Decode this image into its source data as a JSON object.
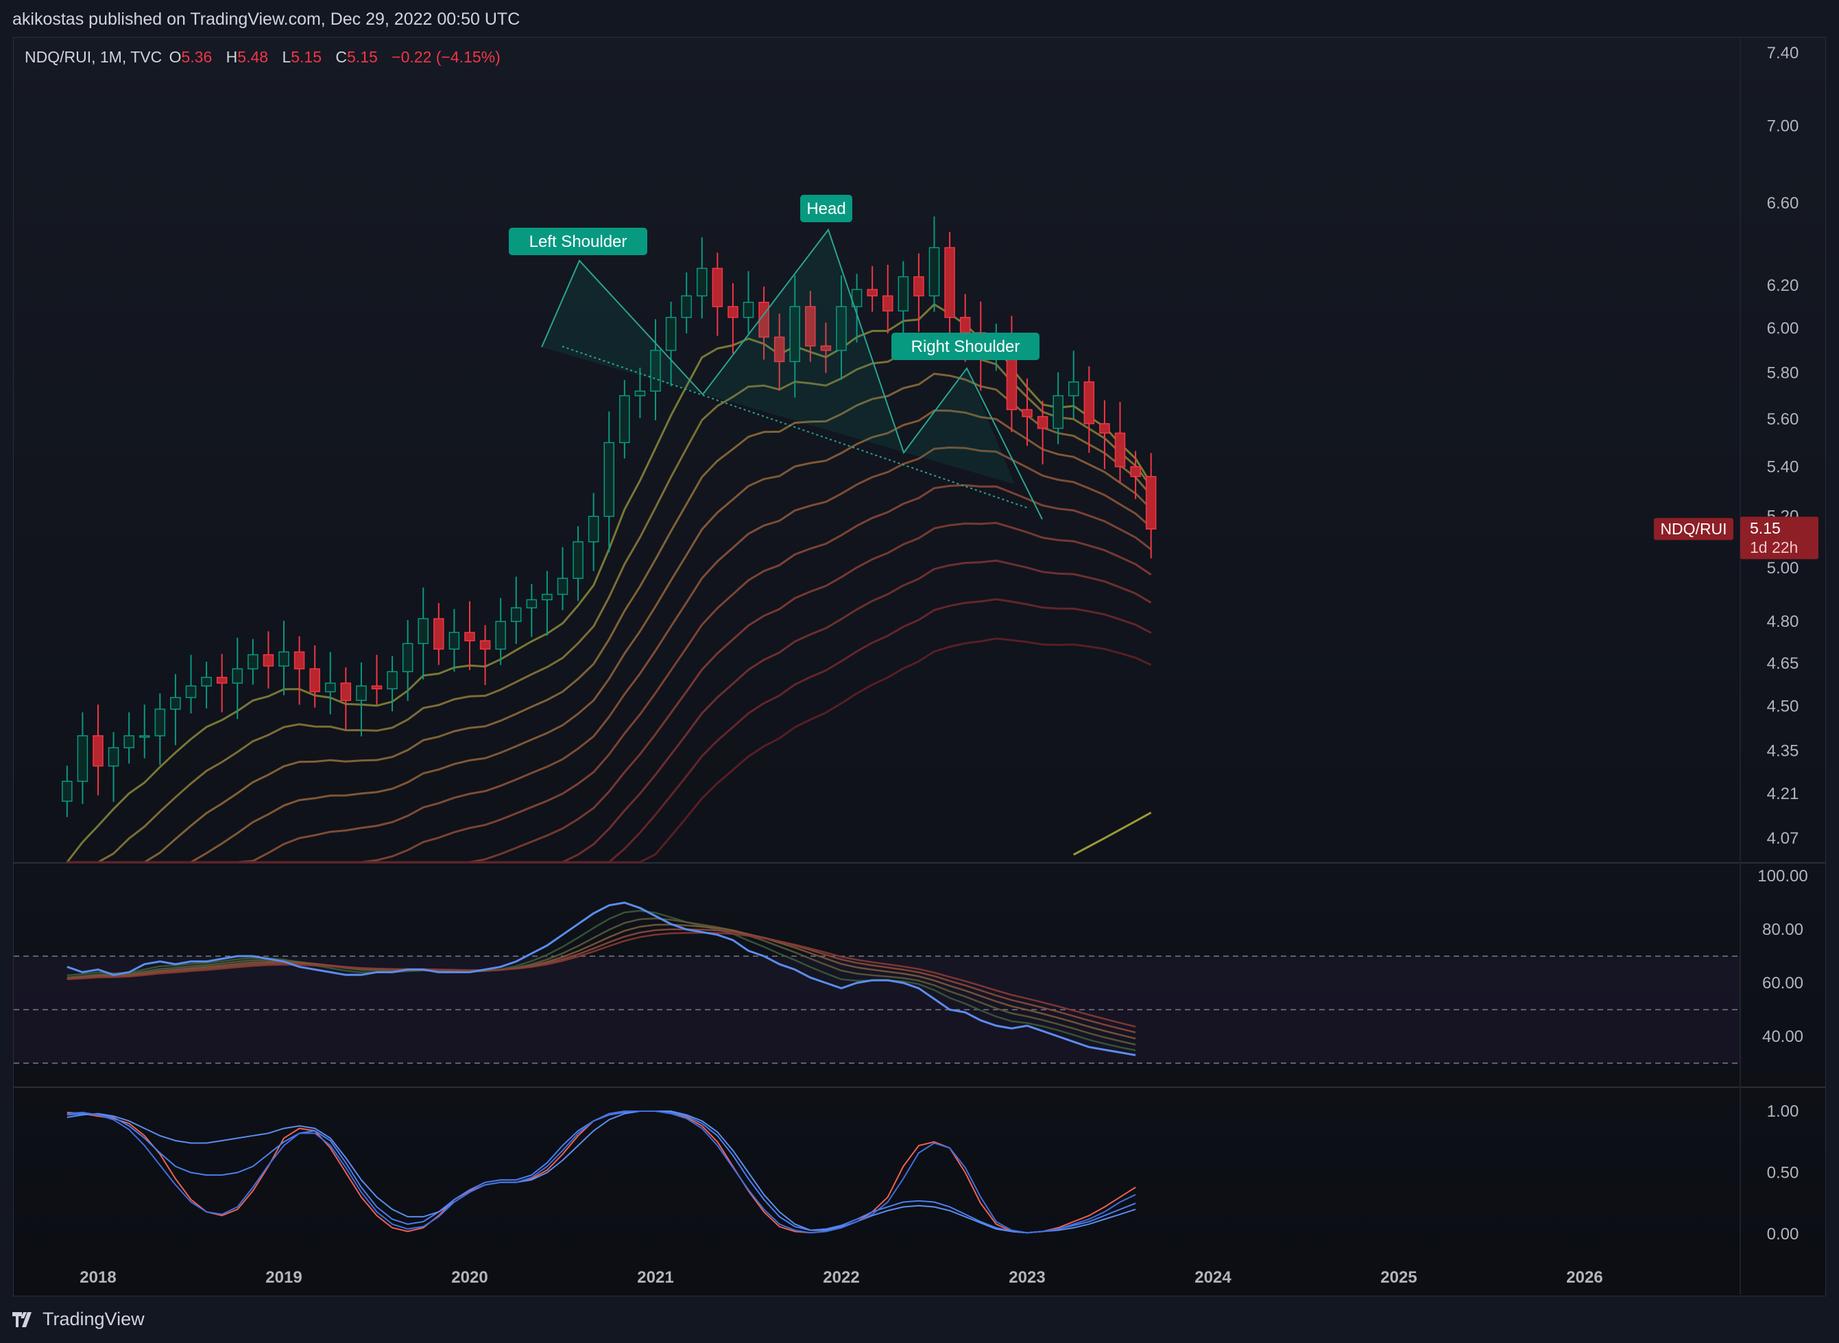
{
  "header": {
    "publisher": "akikostas published on TradingView.com, Dec 29, 2022 00:50 UTC"
  },
  "legend": {
    "symbol": "NDQ/RUI, 1M, TVC",
    "open_label": "O",
    "open": "5.36",
    "high_label": "H",
    "high": "5.48",
    "low_label": "L",
    "low": "5.15",
    "close_label": "C",
    "close": "5.15",
    "change": "−0.22 (−4.15%)"
  },
  "price_tag": {
    "symbol": "NDQ/RUI",
    "price": "5.15",
    "countdown": "1d 22h"
  },
  "annotations": {
    "left_shoulder": "Left Shoulder",
    "head": "Head",
    "right_shoulder": "Right Shoulder"
  },
  "footer": {
    "brand": "TradingView"
  },
  "colors": {
    "up": "#089981",
    "down": "#f23645",
    "rsi_line": "#5b8def",
    "background": "#131722"
  },
  "chart_data": [
    {
      "type": "candlestick",
      "title": "NDQ/RUI, 1M, TVC",
      "scale": "log",
      "ylim": [
        4.0,
        7.5
      ],
      "yticks": [
        7.4,
        7.0,
        6.6,
        6.2,
        6.0,
        5.8,
        5.6,
        5.4,
        5.2,
        5.0,
        4.8,
        4.65,
        4.5,
        4.35,
        4.21,
        4.07
      ],
      "xticks": [
        "2018",
        "2019",
        "2020",
        "2021",
        "2022",
        "2023",
        "2024",
        "2025",
        "2026"
      ],
      "last_price": 5.15,
      "ohlc_last": {
        "open": 5.36,
        "high": 5.48,
        "low": 5.15,
        "close": 5.15
      },
      "closes_monthly_2017_11_to_2022_12": [
        4.25,
        4.4,
        4.3,
        4.36,
        4.4,
        4.4,
        4.49,
        4.53,
        4.57,
        4.6,
        4.58,
        4.63,
        4.68,
        4.64,
        4.69,
        4.63,
        4.55,
        4.58,
        4.52,
        4.57,
        4.56,
        4.62,
        4.72,
        4.81,
        4.7,
        4.76,
        4.73,
        4.7,
        4.8,
        4.85,
        4.88,
        4.9,
        4.96,
        5.1,
        5.2,
        5.5,
        5.7,
        5.72,
        5.9,
        6.05,
        6.15,
        6.28,
        6.1,
        6.05,
        6.12,
        5.96,
        5.85,
        6.1,
        5.92,
        5.9,
        6.1,
        6.18,
        6.15,
        6.08,
        6.24,
        6.15,
        6.38,
        6.05,
        5.98,
        5.88,
        5.95,
        5.64,
        5.61,
        5.56,
        5.7,
        5.76,
        5.58,
        5.54,
        5.4,
        5.36,
        5.15
      ],
      "patterns": [
        "Left Shoulder",
        "Head",
        "Right Shoulder"
      ]
    },
    {
      "type": "line",
      "title": "",
      "ylim": [
        30,
        100
      ],
      "yticks": [
        100.0,
        80.0,
        60.0,
        40.0
      ],
      "bands": [
        70,
        50,
        30
      ],
      "series": [
        {
          "values": [
            66,
            64,
            65,
            63,
            64,
            67,
            68,
            67,
            68,
            68,
            69,
            70,
            70,
            69,
            68,
            66,
            65,
            64,
            63,
            63,
            64,
            64,
            65,
            65,
            64,
            64,
            64,
            65,
            66,
            68,
            71,
            74,
            78,
            82,
            86,
            89,
            90,
            88,
            85,
            82,
            80,
            79,
            78,
            76,
            72,
            70,
            67,
            65,
            62,
            60,
            58,
            60,
            61,
            61,
            60,
            58,
            54,
            50,
            49,
            46,
            44,
            43,
            44,
            42,
            40,
            38,
            36,
            35,
            34,
            33
          ]
        }
      ]
    },
    {
      "type": "line",
      "title": "",
      "ylim": [
        0,
        1
      ],
      "yticks": [
        1.0,
        0.5,
        0.0
      ],
      "series": [
        {
          "values": [
            0.99,
            0.98,
            0.96,
            0.94,
            0.9,
            0.8,
            0.65,
            0.45,
            0.28,
            0.18,
            0.15,
            0.2,
            0.35,
            0.55,
            0.78,
            0.86,
            0.84,
            0.7,
            0.5,
            0.3,
            0.15,
            0.05,
            0.02,
            0.05,
            0.15,
            0.28,
            0.35,
            0.4,
            0.42,
            0.42,
            0.45,
            0.52,
            0.65,
            0.8,
            0.92,
            0.98,
            1.0,
            1.0,
            1.0,
            0.99,
            0.95,
            0.88,
            0.75,
            0.55,
            0.35,
            0.18,
            0.06,
            0.02,
            0.01,
            0.02,
            0.05,
            0.1,
            0.18,
            0.3,
            0.55,
            0.72,
            0.75,
            0.7,
            0.5,
            0.25,
            0.08,
            0.02,
            0.01,
            0.02,
            0.05,
            0.1,
            0.15,
            0.22,
            0.3,
            0.38
          ]
        },
        {
          "values": [
            0.97,
            0.98,
            0.97,
            0.95,
            0.88,
            0.78,
            0.66,
            0.55,
            0.5,
            0.48,
            0.48,
            0.5,
            0.55,
            0.65,
            0.75,
            0.82,
            0.84,
            0.76,
            0.58,
            0.38,
            0.22,
            0.12,
            0.08,
            0.1,
            0.18,
            0.28,
            0.36,
            0.42,
            0.44,
            0.44,
            0.48,
            0.58,
            0.72,
            0.84,
            0.92,
            0.97,
            0.99,
            1.0,
            1.0,
            0.99,
            0.96,
            0.9,
            0.8,
            0.64,
            0.45,
            0.28,
            0.14,
            0.06,
            0.03,
            0.04,
            0.07,
            0.12,
            0.18,
            0.22,
            0.26,
            0.27,
            0.26,
            0.22,
            0.16,
            0.1,
            0.05,
            0.02,
            0.01,
            0.02,
            0.04,
            0.07,
            0.1,
            0.15,
            0.2,
            0.25
          ]
        },
        {
          "values": [
            0.95,
            0.97,
            0.98,
            0.96,
            0.92,
            0.86,
            0.8,
            0.76,
            0.74,
            0.74,
            0.76,
            0.78,
            0.8,
            0.82,
            0.86,
            0.88,
            0.86,
            0.78,
            0.62,
            0.44,
            0.3,
            0.2,
            0.14,
            0.14,
            0.18,
            0.26,
            0.34,
            0.4,
            0.42,
            0.42,
            0.44,
            0.5,
            0.6,
            0.72,
            0.84,
            0.93,
            0.98,
            1.0,
            1.0,
            1.0,
            0.97,
            0.92,
            0.83,
            0.68,
            0.5,
            0.32,
            0.18,
            0.08,
            0.03,
            0.03,
            0.06,
            0.1,
            0.15,
            0.19,
            0.22,
            0.23,
            0.22,
            0.19,
            0.14,
            0.09,
            0.04,
            0.02,
            0.01,
            0.02,
            0.03,
            0.05,
            0.08,
            0.12,
            0.16,
            0.2
          ]
        },
        {
          "values": [
            0.98,
            0.99,
            0.97,
            0.93,
            0.85,
            0.72,
            0.56,
            0.4,
            0.26,
            0.18,
            0.16,
            0.22,
            0.38,
            0.56,
            0.72,
            0.82,
            0.82,
            0.72,
            0.54,
            0.34,
            0.18,
            0.08,
            0.04,
            0.06,
            0.14,
            0.26,
            0.34,
            0.4,
            0.42,
            0.42,
            0.46,
            0.55,
            0.68,
            0.82,
            0.92,
            0.98,
            1.0,
            1.0,
            1.0,
            0.98,
            0.94,
            0.86,
            0.72,
            0.54,
            0.36,
            0.2,
            0.08,
            0.03,
            0.01,
            0.02,
            0.05,
            0.1,
            0.16,
            0.26,
            0.45,
            0.66,
            0.74,
            0.7,
            0.54,
            0.3,
            0.1,
            0.03,
            0.01,
            0.02,
            0.04,
            0.08,
            0.12,
            0.18,
            0.26,
            0.32
          ]
        }
      ]
    }
  ]
}
